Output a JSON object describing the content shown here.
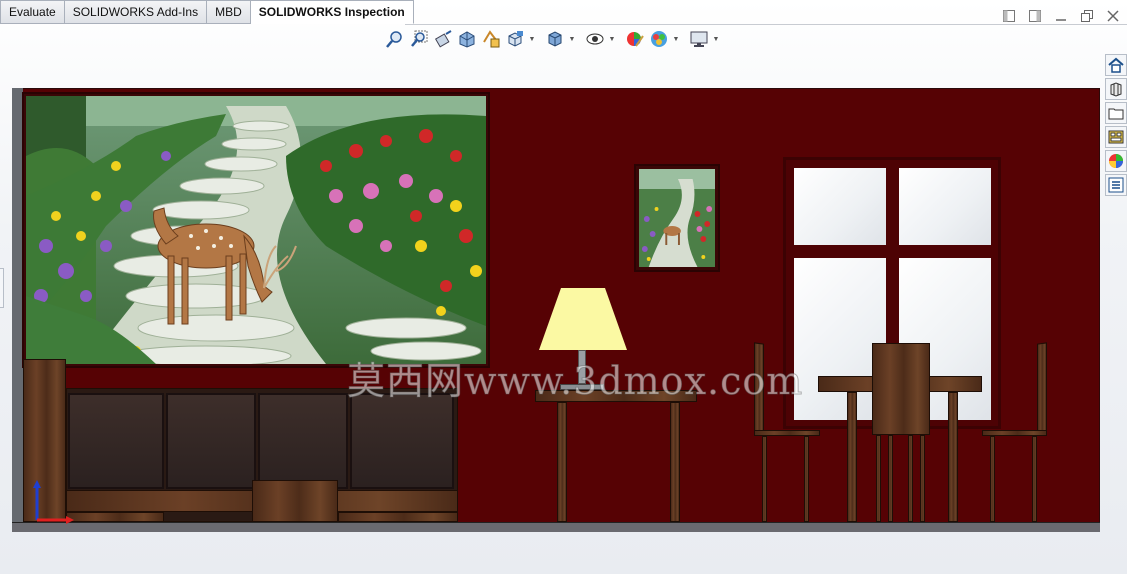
{
  "tabs": [
    {
      "label": "Evaluate",
      "active": false
    },
    {
      "label": "SOLIDWORKS Add-Ins",
      "active": false
    },
    {
      "label": "MBD",
      "active": false
    },
    {
      "label": "SOLIDWORKS Inspection",
      "active": true
    }
  ],
  "hud_toolbar": [
    {
      "icon": "zoom-to-fit-icon",
      "dropdown": false
    },
    {
      "icon": "zoom-to-area-icon",
      "dropdown": false
    },
    {
      "icon": "previous-view-icon",
      "dropdown": false
    },
    {
      "icon": "section-view-icon",
      "dropdown": false
    },
    {
      "icon": "dynamic-annotation-views-icon",
      "dropdown": false
    },
    {
      "icon": "view-orientation-icon",
      "dropdown": true
    },
    {
      "icon": "display-style-icon",
      "dropdown": true
    },
    {
      "icon": "hide-show-items-icon",
      "dropdown": true
    },
    {
      "icon": "edit-appearance-icon",
      "dropdown": false
    },
    {
      "icon": "apply-scene-icon",
      "dropdown": true
    },
    {
      "icon": "view-settings-icon",
      "dropdown": true
    }
  ],
  "window_controls": [
    "pane-left-icon",
    "pane-right-icon",
    "minimize-icon",
    "restore-icon",
    "close-icon"
  ],
  "task_pane": [
    "home-icon",
    "design-library-icon",
    "file-explorer-icon",
    "view-palette-icon",
    "appearances-icon",
    "custom-properties-icon"
  ],
  "watermark": "莫西网www.3dmox.com",
  "colors": {
    "wall": "#560204",
    "lamp_shade": "#fbf9a3",
    "triad_y": "#1f3fd0",
    "triad_x": "#e02020"
  }
}
